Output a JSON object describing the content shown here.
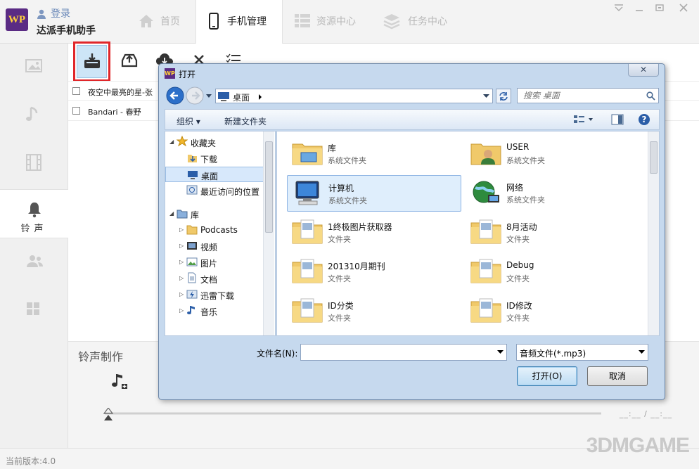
{
  "app": {
    "logo_text": "WP",
    "login_label": "登录",
    "name": "达派手机助手",
    "version_text": "当前版本:4.0",
    "watermark": "3DMGAME"
  },
  "nav": {
    "tabs": [
      {
        "label": "首页",
        "icon": "home-icon"
      },
      {
        "label": "手机管理",
        "icon": "phone-icon",
        "active": true
      },
      {
        "label": "资源中心",
        "icon": "grid-icon"
      },
      {
        "label": "任务中心",
        "icon": "stack-icon"
      }
    ]
  },
  "sidebar": {
    "items": [
      {
        "icon": "photo-icon",
        "label": ""
      },
      {
        "icon": "music-icon",
        "label": ""
      },
      {
        "icon": "film-icon",
        "label": ""
      },
      {
        "icon": "bell-icon",
        "label": "铃声",
        "active": true
      },
      {
        "icon": "contacts-icon",
        "label": ""
      },
      {
        "icon": "apps-icon",
        "label": ""
      }
    ]
  },
  "toolbar": {
    "buttons": [
      "download-icon",
      "upload-icon",
      "cloud-icon",
      "delete-icon",
      "list-icon"
    ]
  },
  "songs": [
    {
      "name": "夜空中最亮的星-张"
    },
    {
      "name": "Bandari - 春野"
    }
  ],
  "ringtone": {
    "title": "铃声制作",
    "time": "__:__ / __:__"
  },
  "dialog": {
    "title": "打开",
    "close_label": "✕",
    "address": "桌面",
    "search_placeholder": "搜索 桌面",
    "organize_label": "组织",
    "new_folder_label": "新建文件夹",
    "tree": [
      {
        "label": "收藏夹",
        "level": 0,
        "expand": "◢",
        "icon": "star-icon"
      },
      {
        "label": "下载",
        "level": 1,
        "icon": "download-folder-icon"
      },
      {
        "label": "桌面",
        "level": 1,
        "icon": "desktop-icon",
        "selected": true
      },
      {
        "label": "最近访问的位置",
        "level": 1,
        "icon": "recent-icon"
      },
      {
        "label": "库",
        "level": 0,
        "expand": "◢",
        "icon": "library-icon"
      },
      {
        "label": "Podcasts",
        "level": 1,
        "expand": "▷",
        "icon": "folder-icon"
      },
      {
        "label": "视频",
        "level": 1,
        "expand": "▷",
        "icon": "video-icon"
      },
      {
        "label": "图片",
        "level": 1,
        "expand": "▷",
        "icon": "picture-icon"
      },
      {
        "label": "文档",
        "level": 1,
        "expand": "▷",
        "icon": "document-icon"
      },
      {
        "label": "迅雷下载",
        "level": 1,
        "expand": "▷",
        "icon": "thunder-icon"
      },
      {
        "label": "音乐",
        "level": 1,
        "expand": "▷",
        "icon": "music-note-icon"
      }
    ],
    "files": [
      {
        "name": "库",
        "type": "系统文件夹",
        "icon": "library-icon"
      },
      {
        "name": "USER",
        "type": "系统文件夹",
        "icon": "user-icon"
      },
      {
        "name": "计算机",
        "type": "系统文件夹",
        "icon": "computer-icon",
        "selected": true
      },
      {
        "name": "网络",
        "type": "系统文件夹",
        "icon": "network-icon"
      },
      {
        "name": "1终极图片获取器",
        "type": "文件夹",
        "icon": "folder-icon"
      },
      {
        "name": "8月活动",
        "type": "文件夹",
        "icon": "folder-icon"
      },
      {
        "name": "201310月期刊",
        "type": "文件夹",
        "icon": "folder-icon"
      },
      {
        "name": "Debug",
        "type": "文件夹",
        "icon": "folder-icon"
      },
      {
        "name": "ID分类",
        "type": "文件夹",
        "icon": "folder-icon"
      },
      {
        "name": "ID修改",
        "type": "文件夹",
        "icon": "folder-icon"
      }
    ],
    "filename_label": "文件名(N):",
    "filename_value": "",
    "filetype_value": "音频文件(*.mp3)",
    "open_label": "打开(O)",
    "cancel_label": "取消"
  }
}
